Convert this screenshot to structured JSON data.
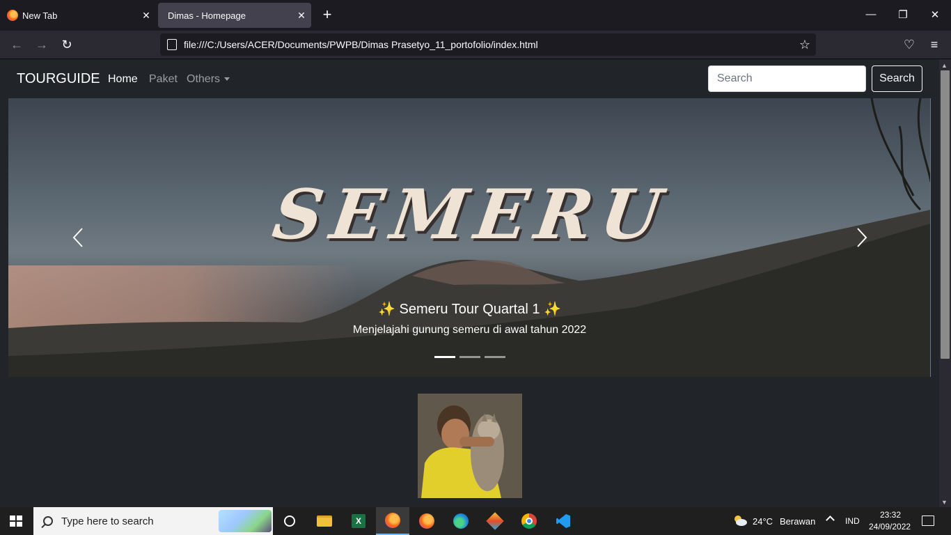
{
  "browser": {
    "tabs": [
      {
        "title": "New Tab",
        "active": false
      },
      {
        "title": "Dimas - Homepage",
        "active": true
      }
    ],
    "url": "file:///C:/Users/ACER/Documents/PWPB/Dimas Prasetyo_11_portofolio/index.html"
  },
  "navbar": {
    "brand": "TOURGUIDE",
    "links": [
      "Home",
      "Paket",
      "Others"
    ],
    "search_placeholder": "Search",
    "search_button": "Search"
  },
  "carousel": {
    "hero_text": "SEMERU",
    "caption_title": "✨ Semeru Tour Quartal 1 ✨",
    "caption_text": "Menjelajahi gunung semeru di awal tahun 2022",
    "active_slide": 1,
    "slide_count": 3
  },
  "taskbar": {
    "search_placeholder": "Type here to search",
    "weather_temp": "24°C",
    "weather_desc": "Berawan",
    "language": "IND",
    "time": "23:32",
    "date": "24/09/2022"
  }
}
